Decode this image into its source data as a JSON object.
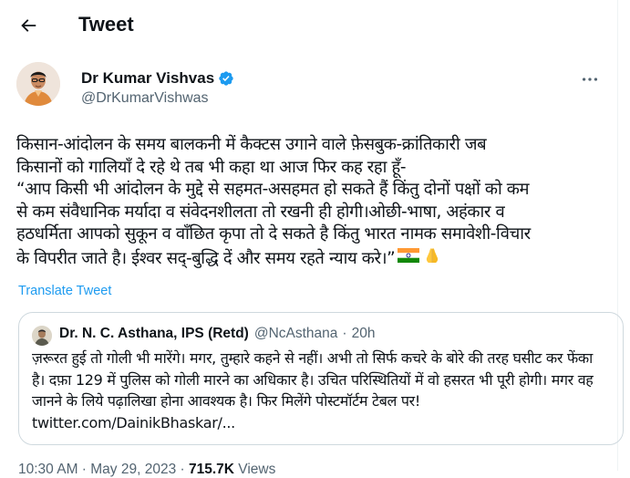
{
  "header": {
    "title": "Tweet",
    "back_icon": "arrow-left-icon"
  },
  "author": {
    "name": "Dr Kumar Vishvas",
    "handle": "@DrKumarVishwas",
    "verified_color": "#1d9bf0"
  },
  "tweet": {
    "text": "किसान-आंदोलन के समय बालकनी में कैक्टस उगाने वाले फ़ेसबुक-क्रांतिकारी जब\nकिसानों को गालियाँ दे रहे थे तब भी कहा था आज फिर कह रहा हूँ-\n“आप किसी भी आंदोलन के मुद्दे से सहमत-असहमत हो सकते हैं किंतु दोनों पक्षों को कम\nसे कम संवैधानिक मर्यादा व संवेदनशीलता तो रखनी ही होगी।ओछी-भाषा, अहंकार व\nहठधर्मिता आपको सुकून व वाँछित कृपा तो दे सकते है किंतु भारत नामक समावेशी-विचार\nके विपरीत जाते है। ईश्वर सद्-बुद्धि दें और समय रहते न्याय करे।”",
    "emojis": [
      "india-flag-icon",
      "folded-hands-icon"
    ],
    "translate_label": "Translate Tweet"
  },
  "quote": {
    "name": "Dr. N. C. Asthana, IPS (Retd)",
    "handle": "@NcAsthana",
    "dot": "·",
    "time": "20h",
    "text": "ज़रूरत हुई तो गोली भी मारेंगे। मगर, तुम्हारे कहने से नहीं। अभी तो सिर्फ कचरे के बोरे की तरह घसीट कर फेंका है। दफ़ा 129 में पुलिस को गोली मारने का अधिकार है। उचित परिस्थितियों में वो हसरत भी पूरी होगी। मगर वह जानने के लिये पढ़ालिखा होना आवश्यक है। फिर मिलेंगे पोस्टमॉर्टम टेबल पर! twitter.com/DainikBhaskar/..."
  },
  "meta": {
    "time": "10:30 AM · May 29, 2023",
    "dot": "·",
    "views_count": "715.7K",
    "views_label": "Views"
  },
  "colors": {
    "link": "#1d9bf0",
    "secondary_text": "#536471",
    "border": "#cfd9de"
  }
}
